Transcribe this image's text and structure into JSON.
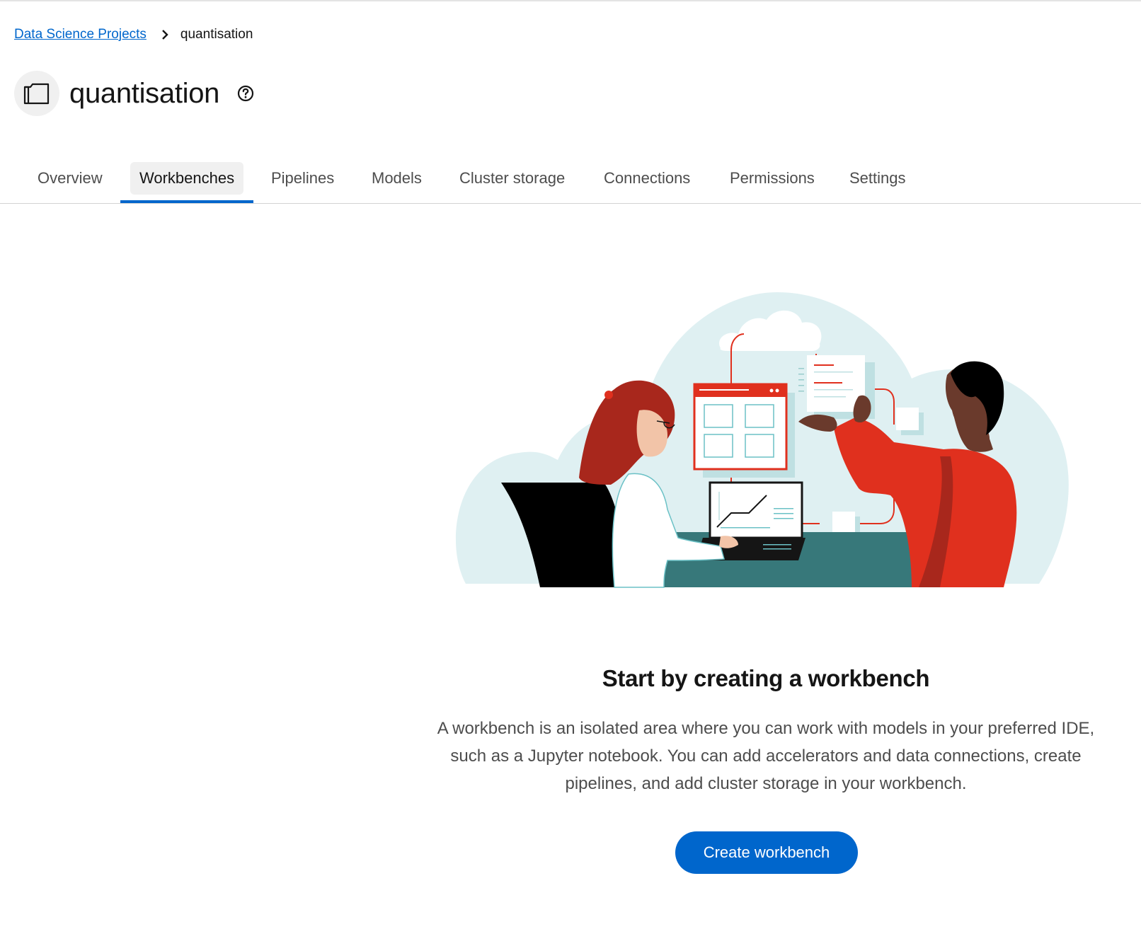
{
  "breadcrumb": {
    "parent_label": "Data Science Projects",
    "current_label": "quantisation"
  },
  "header": {
    "title": "quantisation",
    "icon": "project-folder-icon",
    "help_icon": "question-circle-icon"
  },
  "tabs": [
    {
      "label": "Overview",
      "active": false
    },
    {
      "label": "Workbenches",
      "active": true
    },
    {
      "label": "Pipelines",
      "active": false
    },
    {
      "label": "Models",
      "active": false
    },
    {
      "label": "Cluster storage",
      "active": false
    },
    {
      "label": "Connections",
      "active": false
    },
    {
      "label": "Permissions",
      "active": false
    },
    {
      "label": "Settings",
      "active": false
    }
  ],
  "empty_state": {
    "title": "Start by creating a workbench",
    "body": "A workbench is an isolated area where you can work with models in your preferred IDE, such as a Jupyter notebook. You can add accelerators and data connections, create pipelines, and add cluster storage in your workbench.",
    "button_label": "Create workbench"
  },
  "colors": {
    "link": "#0066cc",
    "primary_button": "#0066cc",
    "tab_active_underline": "#0066cc",
    "illustration_red": "#e0301e",
    "illustration_teal": "#37787a",
    "illustration_bg": "#dff0f2"
  }
}
